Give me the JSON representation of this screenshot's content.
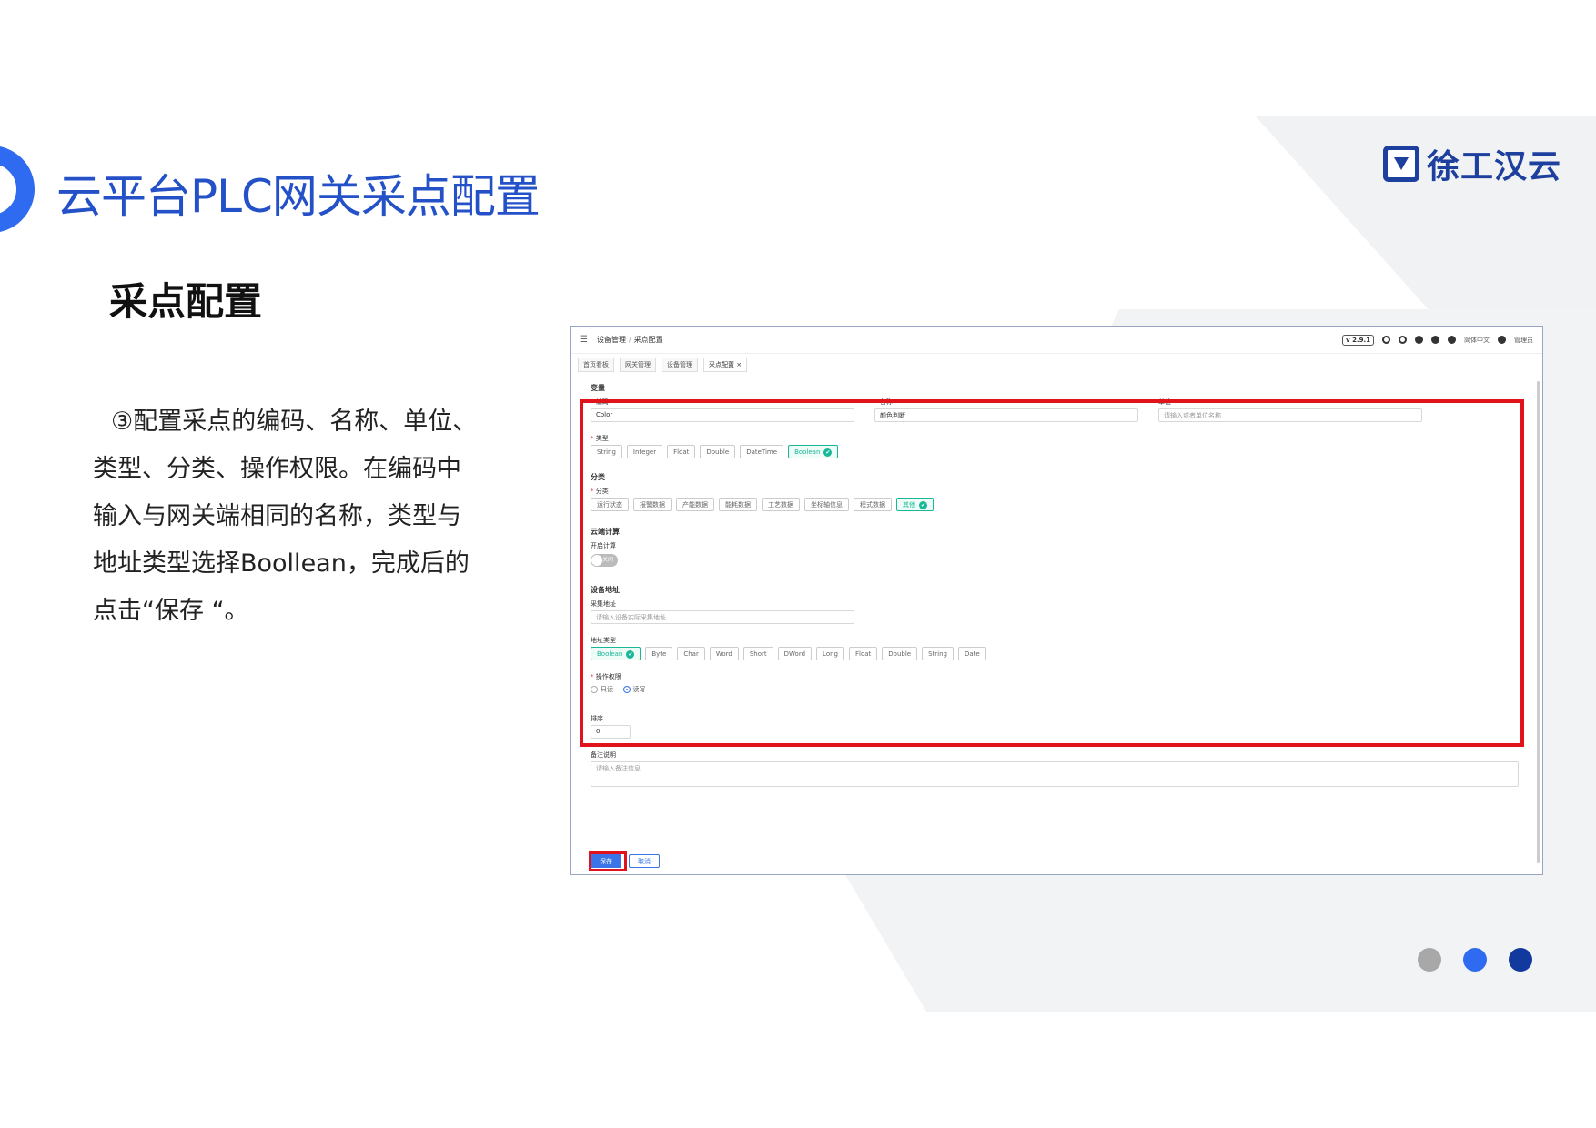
{
  "slide": {
    "title": "云平台PLC网关采点配置",
    "logo_text": "徐工汉云",
    "subtitle": "采点配置",
    "description_lines": [
      "③配置采点的编码、名称、单位、",
      "类型、分类、操作权限。在编码中",
      "输入与网关端相同的名称，类型与",
      "地址类型选择Boollean，完成后的",
      "点击“保存 “。"
    ],
    "dot_colors": [
      "#a8a8a8",
      "#2f6bf0",
      "#123a9e"
    ]
  },
  "app": {
    "breadcrumb": [
      "设备管理",
      "采点配置"
    ],
    "version": "v 2.9.1",
    "language": "简体中文",
    "user": "管理员",
    "tabs": [
      "首页看板",
      "网关管理",
      "设备管理",
      "采点配置 ×"
    ],
    "form": {
      "section_variable": "变量",
      "code_label": "编码",
      "code_value": "Color",
      "name_label": "名称",
      "name_value": "颜色判断",
      "unit_label": "单位",
      "unit_placeholder": "请输入或者单位名称",
      "type_label": "类型",
      "type_options": [
        "String",
        "Integer",
        "Float",
        "Double",
        "DateTime",
        "Boolean"
      ],
      "type_selected": "Boolean",
      "section_category": "分类",
      "category_label": "分类",
      "category_options": [
        "运行状态",
        "报警数据",
        "产能数据",
        "能耗数据",
        "工艺数据",
        "坐标轴信息",
        "程式数据",
        "其他"
      ],
      "category_selected": "其他",
      "section_cloud": "云端计算",
      "cloud_label": "开启计算",
      "cloud_toggle_text": "关闭",
      "section_address": "设备地址",
      "address_label": "采集地址",
      "address_placeholder": "请输入设备实际采集地址",
      "address_type_label": "地址类型",
      "address_type_options": [
        "Boolean",
        "Byte",
        "Char",
        "Word",
        "Short",
        "DWord",
        "Long",
        "Float",
        "Double",
        "String",
        "Date"
      ],
      "address_type_selected": "Boolean",
      "permission_label": "操作权限",
      "permission_options": [
        "只读",
        "读写"
      ],
      "permission_selected": "读写",
      "order_label": "排序",
      "order_value": "0",
      "remark_label": "备注说明",
      "remark_placeholder": "请输入备注信息",
      "save_label": "保存",
      "cancel_label": "取消"
    }
  }
}
